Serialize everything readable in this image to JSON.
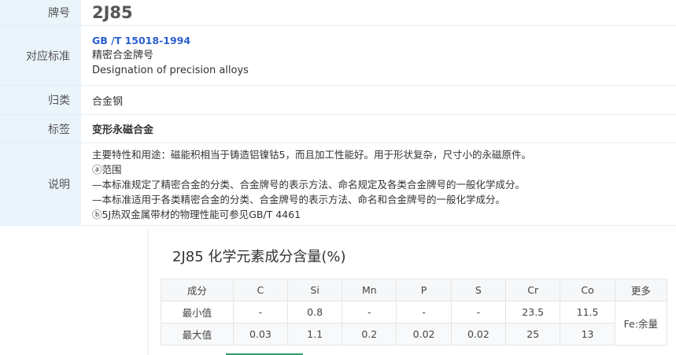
{
  "info": {
    "grade_label": "牌号",
    "grade_value": "2J85",
    "standard_label": "对应标准",
    "standard_code": "GB /T 15018-1994",
    "standard_name_cn": "精密合金牌号",
    "standard_name_en": "Designation of precision alloys",
    "category_label": "归类",
    "category_value": "合金钢",
    "tag_label": "标签",
    "tag_value": "变形永磁合金",
    "desc_label": "说明",
    "desc_lines": [
      "主要特性和用途：磁能积相当于铸造铝镍钴5，而且加工性能好。用于形状复杂，尺寸小的永磁原件。",
      "ⓐ范围",
      "—本标准规定了精密合金的分类、合金牌号的表示方法、命名规定及各类合金牌号的一般化学成分。",
      "—本标准适用于各类精密合金的分类、合金牌号的表示方法、命名和合金牌号的一般化学成分。",
      "ⓑ5J热双金属带材的物理性能可参见GB/T 4461"
    ]
  },
  "composition": {
    "title": "2J85 化学元素成分含量(%)",
    "headers": [
      "成分",
      "C",
      "Si",
      "Mn",
      "P",
      "S",
      "Cr",
      "Co",
      "更多"
    ],
    "rows": [
      {
        "label": "最小值",
        "values": [
          "-",
          "0.8",
          "-",
          "-",
          "-",
          "23.5",
          "11.5"
        ]
      },
      {
        "label": "最大值",
        "values": [
          "0.03",
          "1.1",
          "0.2",
          "0.02",
          "0.02",
          "25",
          "13"
        ]
      }
    ],
    "more_value": "Fe:余量"
  },
  "colors": {
    "label_bg": "#eaf4fb",
    "link": "#2a5fcc",
    "accent_green": "#2e9e6a"
  }
}
